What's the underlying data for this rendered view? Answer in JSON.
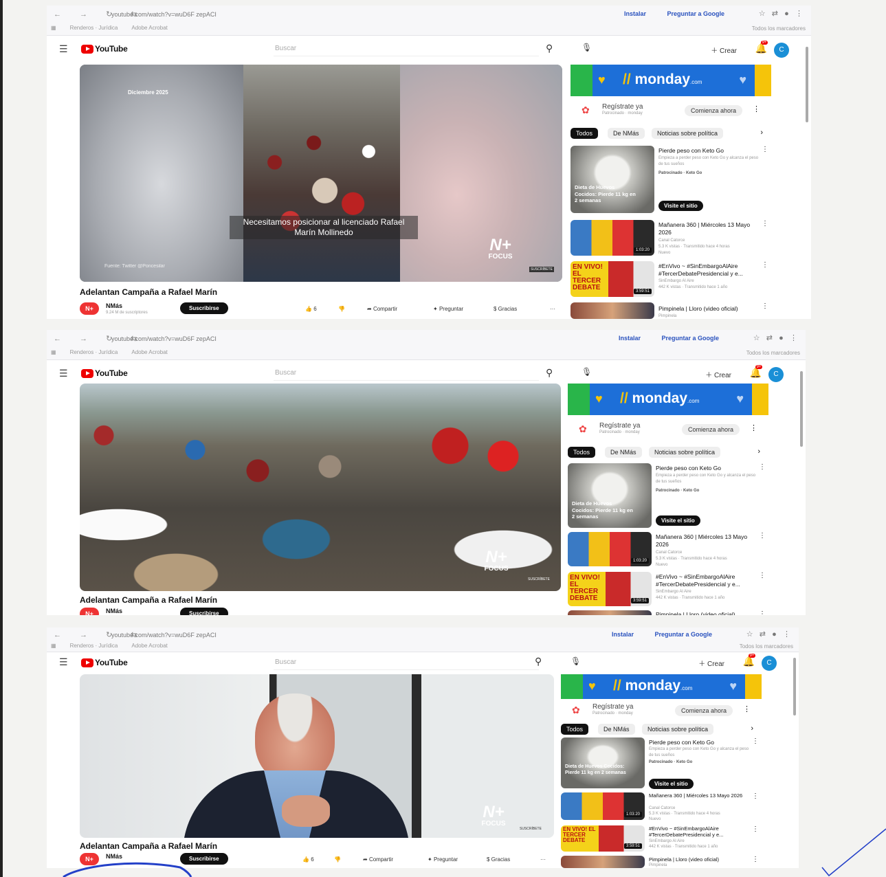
{
  "browser": {
    "url": "youtube.com/watch?v=wuD6F zepACI",
    "install_label": "Instalar",
    "ask_google_label": "Preguntar a Google",
    "bookmarks": [
      "Renderos · Jurídica",
      "Adobe Acrobat"
    ],
    "all_bookmarks_label": "Todos los marcadores"
  },
  "youtube": {
    "logo_text": "YouTube",
    "search_placeholder": "Buscar",
    "create_label": "Crear",
    "avatar_letter": "C"
  },
  "video": {
    "title": "Adelantan Campaña a Rafael Marín",
    "date_overlay": "Diciembre 2025",
    "caption": "Necesitamos posicionar al licenciado Rafael Marín Mollinedo",
    "brand_big": "N+",
    "brand_small": "FOCUS",
    "subscribe_badge": "SUSCRÍBETE",
    "source_credit": "Fuente: Twitter @Poncesilar"
  },
  "channel": {
    "name": "NMás",
    "logo_text": "N+",
    "subscribers": "9.24 M de suscriptores",
    "subscribe_label": "Suscribirse"
  },
  "actions": {
    "likes": "6",
    "share": "Compartir",
    "ask": "Preguntar",
    "thanks": "Gracias",
    "more": "···"
  },
  "sidebar": {
    "ad": {
      "brand": "monday",
      "domain": ".com"
    },
    "sponsor": {
      "title": "Regístrate ya",
      "meta": "Patrocinado · monday",
      "button": "Comienza ahora"
    },
    "chips": [
      "Todos",
      "De NMás",
      "Noticias sobre política"
    ],
    "recommendations": [
      {
        "title": "Pierde peso con Keto Go",
        "sub": "Empieza a perder peso con Keto Go y alcanza el peso de tus sueños",
        "meta": "Patrocinado · Keto Go",
        "thumb_text": "Dieta de Huevos Cocidos: Pierde 11 kg en 2 semanas",
        "button": "Visite el sitio"
      },
      {
        "title": "Mañanera 360 | Miércoles 13 Mayo 2026",
        "channel": "Canal Catorce",
        "meta": "5.3 K vistas · Transmitido hace 4 horas",
        "badge": "Nuevo",
        "duration": "1:03:20"
      },
      {
        "title": "#EnVivo ~ #SinEmbargoAlAire #TercerDebatePresidencial y e...",
        "channel": "SinEmbargo Al Aire",
        "meta": "442 K vistas · Transmitido hace 1 año",
        "thumb_text": "EN VIVO! EL TERCER DEBATE",
        "duration": "3:59:51"
      },
      {
        "title": "Pimpinela | Lloro (video oficial)",
        "channel": "Pimpinela"
      }
    ]
  },
  "colors": {
    "youtube_red": "#ee0000",
    "monday_blue": "#1d6fd8",
    "monday_yellow": "#f5c40a",
    "monday_green": "#29b54a",
    "link_blue": "#2a52be",
    "ink_blue": "#2340c8"
  }
}
